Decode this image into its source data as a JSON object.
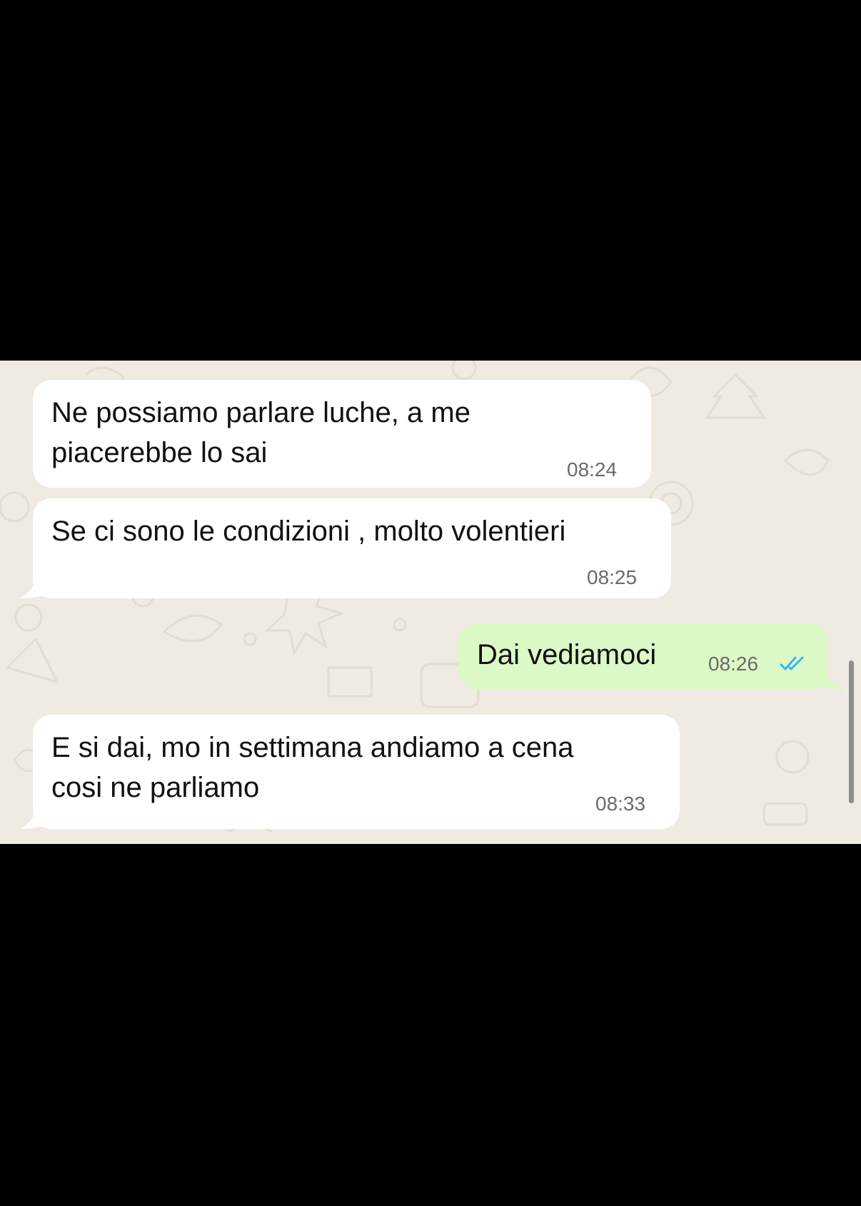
{
  "chat": {
    "messages": [
      {
        "direction": "incoming",
        "text_lines": [
          "Ne possiamo parlare luche, a me",
          "piacerebbe lo sai"
        ],
        "time": "08:24"
      },
      {
        "direction": "incoming",
        "text_lines": [
          "Se ci sono le condizioni , molto volentieri"
        ],
        "time": "08:25"
      },
      {
        "direction": "outgoing",
        "text_lines": [
          "Dai vediamoci"
        ],
        "time": "08:26",
        "status_icon": "double-check-read-icon"
      },
      {
        "direction": "incoming",
        "text_lines": [
          "E si dai, mo in settimana andiamo a cena",
          "cosi ne parliamo"
        ],
        "time": "08:33"
      }
    ]
  },
  "colors": {
    "background": "#000000",
    "chat_background": "#efeae2",
    "incoming_bubble": "#ffffff",
    "outgoing_bubble": "#dcf8c6",
    "read_ticks": "#34b7f1",
    "timestamp": "#6b6b6b"
  }
}
